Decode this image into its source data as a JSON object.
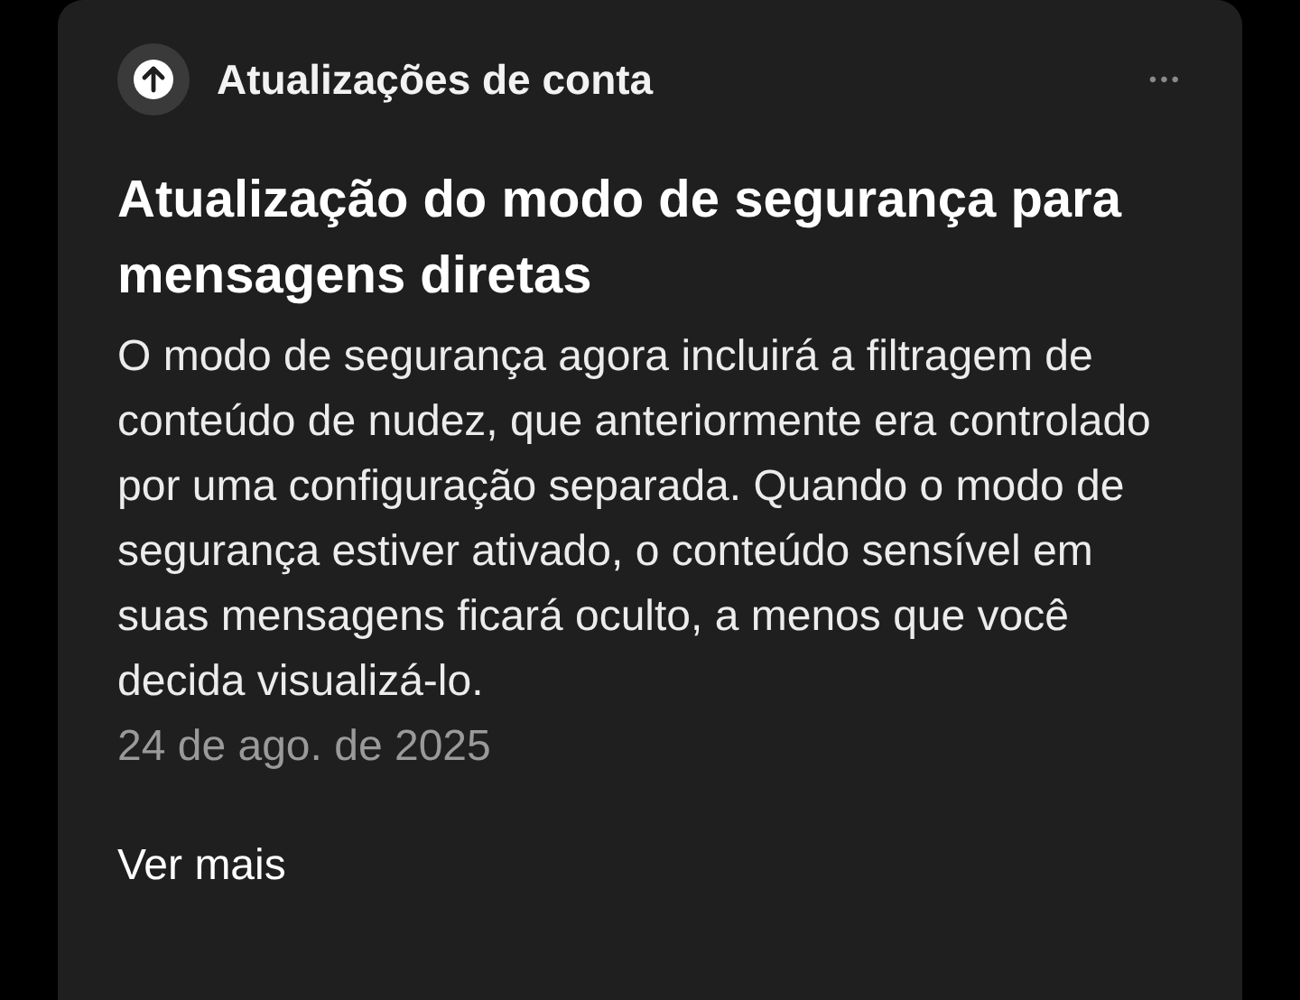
{
  "header": {
    "label": "Atualizações de conta",
    "more": "•••"
  },
  "title": "Atualização do modo de segurança para mensagens diretas",
  "body": "O modo de segurança agora incluirá a filtragem de conteúdo de nudez, que anteriormente era controlado por uma configuração separada. Quando o modo de segurança estiver ativado, o conteúdo sensível em suas mensagens ficará oculto, a menos que você decida visualizá-lo.",
  "date": "24 de ago. de 2025",
  "link": "Ver mais"
}
